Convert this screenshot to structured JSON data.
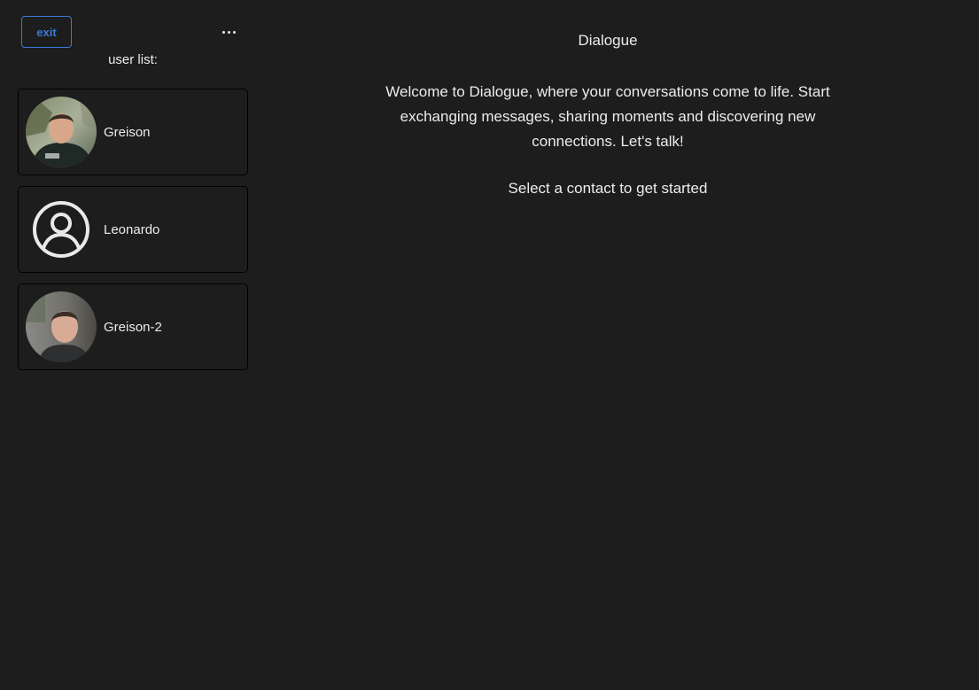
{
  "header": {
    "exit_label": "exit",
    "more_icon": "more-horizontal-icon"
  },
  "sidebar": {
    "list_label": "user list:",
    "users": [
      {
        "name": "Greison",
        "avatar": "photo"
      },
      {
        "name": "Leonardo",
        "avatar": "default-user-icon"
      },
      {
        "name": "Greison-2",
        "avatar": "photo"
      }
    ]
  },
  "main": {
    "title": "Dialogue",
    "welcome": "Welcome to Dialogue, where your conversations come to life. Start exchanging messages, sharing moments and discovering new connections. Let's talk!",
    "hint": "Select a contact to get started"
  },
  "colors": {
    "background": "#1d1d1d",
    "accent": "#3a7bd5",
    "text": "#ececec"
  }
}
